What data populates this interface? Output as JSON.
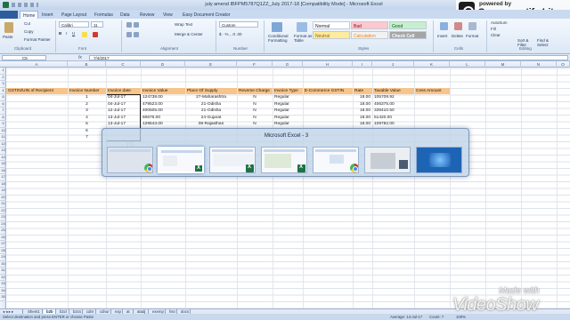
{
  "window": {
    "title": "july amend IBFPM5787Q1ZZ_July 2017-18 [Compatibility Mode] - Microsoft Excel"
  },
  "screencastify": {
    "powered_by": "powered by",
    "name": "Screencastify Lite"
  },
  "ribbon": {
    "tabs": [
      "Home",
      "Insert",
      "Page Layout",
      "Formulas",
      "Data",
      "Review",
      "View",
      "Easy Document Creator"
    ],
    "clipboard": {
      "paste": "Paste",
      "cut": "Cut",
      "copy": "Copy",
      "format_painter": "Format Painter",
      "label": "Clipboard"
    },
    "font": {
      "name": "Calibri",
      "size": "11",
      "label": "Font"
    },
    "alignment": {
      "wrap": "Wrap Text",
      "merge": "Merge & Center",
      "label": "Alignment"
    },
    "number": {
      "format": "Custom",
      "label": "Number"
    },
    "conditional": "Conditional Formatting",
    "format_table": "Format as Table",
    "styles": {
      "normal": "Normal",
      "bad": "Bad",
      "good": "Good",
      "neutral": "Neutral",
      "calculation": "Calculation",
      "check_cell": "Check Cell",
      "label": "Styles"
    },
    "cells": {
      "insert": "Insert",
      "delete": "Delete",
      "format": "Format",
      "label": "Cells"
    },
    "editing": {
      "autosum": "AutoSum",
      "fill": "Fill",
      "clear": "Clear",
      "sort": "Sort & Filter",
      "find": "Find & Select",
      "label": "Editing"
    }
  },
  "formula_bar": {
    "name_box": "C5",
    "fx": "fx",
    "value": "7/4/2017"
  },
  "grid": {
    "columns": [
      "A",
      "B",
      "C",
      "D",
      "E",
      "F",
      "G",
      "H",
      "I",
      "J",
      "K",
      "L",
      "M",
      "N",
      "O"
    ],
    "rows": [
      "1",
      "2",
      "3",
      "4",
      "5",
      "6",
      "7",
      "8",
      "9",
      "10",
      "11",
      "12",
      "13",
      "14",
      "15",
      "16",
      "17",
      "18",
      "19",
      "20",
      "21",
      "22",
      "23",
      "24",
      "25",
      "26",
      "27",
      "28",
      "29",
      "30",
      "31",
      "32",
      "33",
      "34",
      "35"
    ],
    "header": [
      "GSTIN/UIN of Recipient",
      "Invoice Number",
      "Invoice date",
      "Invoice Value",
      "Place Of Supply",
      "Reverse Charge",
      "Invoice Type",
      "E-Commerce GSTIN",
      "Rate",
      "Taxable Value",
      "Cess Amount"
    ],
    "data": [
      [
        "1",
        "04-Jul-17",
        "124738.00",
        "27-Maharashtra",
        "N",
        "Regular",
        "18.00",
        "105709.92"
      ],
      [
        "2",
        "04-Jul-17",
        "479523.00",
        "21-Odisha",
        "N",
        "Regular",
        "18.00",
        "406375.00"
      ],
      [
        "3",
        "12-Jul-17",
        "400505.00",
        "21-Odisha",
        "N",
        "Regular",
        "18.00",
        "339410.50"
      ],
      [
        "4",
        "13-Jul-17",
        "60676.00",
        "24-Gujarat",
        "N",
        "Regular",
        "18.00",
        "51420.00"
      ],
      [
        "5",
        "13-Jul-17",
        "129543.00",
        "08-Rajasthan",
        "N",
        "Regular",
        "18.00",
        "109782.00"
      ],
      [
        "6",
        "",
        "",
        "",
        "",
        "",
        "",
        ""
      ],
      [
        "7",
        "",
        "",
        "",
        "",
        "",
        "",
        ""
      ]
    ]
  },
  "switcher": {
    "title": "Microsoft Excel - 3"
  },
  "sheet_tabs": [
    "Sheet1",
    "b2b",
    "b2cl",
    "b2cs",
    "cdnr",
    "cdnur",
    "exp",
    "at",
    "atadj",
    "exemp",
    "hsn",
    "docs"
  ],
  "status": {
    "left": "Select destination and press ENTER or choose Paste",
    "average": "Average: 14-Jul-17",
    "count": "Count: 7",
    "zoom": "100%"
  },
  "watermark": {
    "made": "Made with",
    "brand": "VideoShow"
  }
}
